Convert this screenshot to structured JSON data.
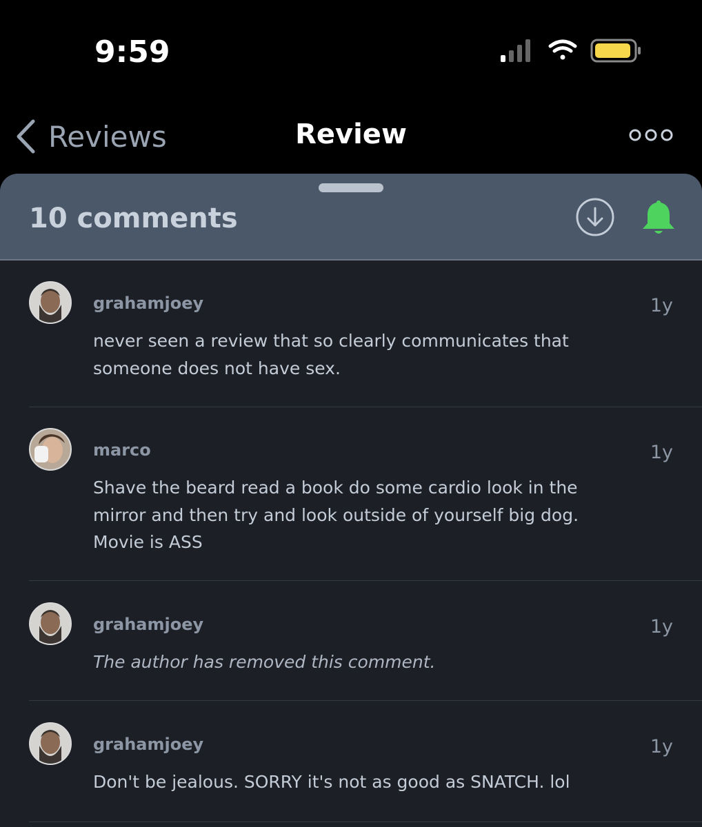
{
  "status_bar": {
    "time": "9:59",
    "icons": [
      "signal-icon",
      "wifi-icon",
      "battery-icon"
    ]
  },
  "nav": {
    "back_label": "Reviews",
    "title": "Review",
    "more_icon": "more-options-icon"
  },
  "sheet": {
    "comment_count_label": "10 comments",
    "icons": [
      "download-icon",
      "bell-icon"
    ],
    "colors": {
      "header_bg": "#4b5869",
      "sheet_bg": "#1c1f25",
      "bell": "#4ed35f"
    }
  },
  "comments": [
    {
      "username": "grahamjoey",
      "age": "1y",
      "text": "never seen a review that so clearly communicates that someone does not have sex.",
      "removed": false
    },
    {
      "username": "marco",
      "age": "1y",
      "text": "Shave the beard read a book do some cardio look in the mirror and then try and look outside of yourself big dog. Movie is ASS",
      "removed": false
    },
    {
      "username": "grahamjoey",
      "age": "1y",
      "text": "The author has removed this comment.",
      "removed": true
    },
    {
      "username": "grahamjoey",
      "age": "1y",
      "text": "Don't be jealous. SORRY it's not as good as SNATCH. lol",
      "removed": false
    }
  ]
}
